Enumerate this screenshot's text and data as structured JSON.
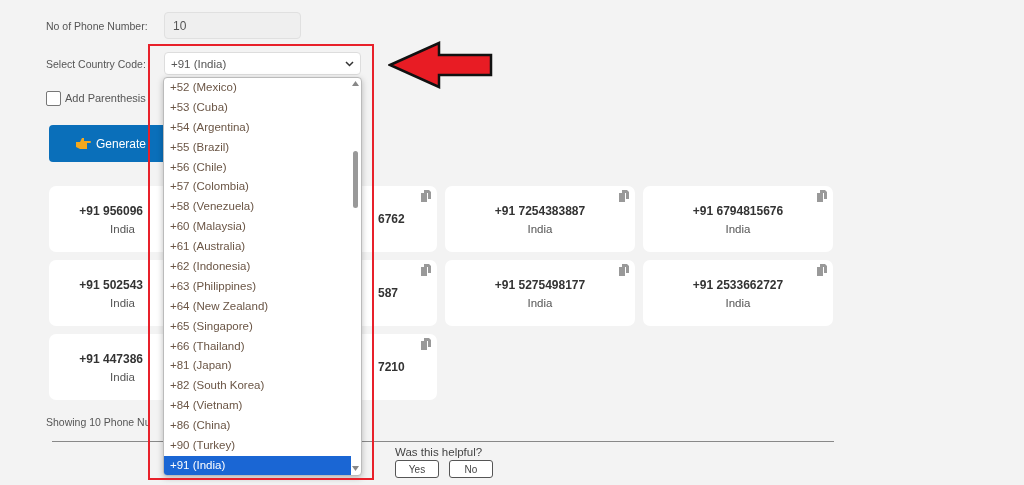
{
  "form": {
    "count_label": "No of Phone Number:",
    "count_value": "10",
    "country_label": "Select Country Code:",
    "country_value": "+91 (India)",
    "parenthesis": {
      "label": "Add Parenthesis",
      "checked": false
    },
    "generate_button": {
      "label": "Generate"
    }
  },
  "dropdown": {
    "options": [
      {
        "label": "+52 (Mexico)",
        "selected": false
      },
      {
        "label": "+53 (Cuba)",
        "selected": false
      },
      {
        "label": "+54 (Argentina)",
        "selected": false
      },
      {
        "label": "+55 (Brazil)",
        "selected": false
      },
      {
        "label": "+56 (Chile)",
        "selected": false
      },
      {
        "label": "+57 (Colombia)",
        "selected": false
      },
      {
        "label": "+58 (Venezuela)",
        "selected": false
      },
      {
        "label": "+60 (Malaysia)",
        "selected": false
      },
      {
        "label": "+61 (Australia)",
        "selected": false
      },
      {
        "label": "+62 (Indonesia)",
        "selected": false
      },
      {
        "label": "+63 (Philippines)",
        "selected": false
      },
      {
        "label": "+64 (New Zealand)",
        "selected": false
      },
      {
        "label": "+65 (Singapore)",
        "selected": false
      },
      {
        "label": "+66 (Thailand)",
        "selected": false
      },
      {
        "label": "+81 (Japan)",
        "selected": false
      },
      {
        "label": "+82 (South Korea)",
        "selected": false
      },
      {
        "label": "+84 (Vietnam)",
        "selected": false
      },
      {
        "label": "+86 (China)",
        "selected": false
      },
      {
        "label": "+90 (Turkey)",
        "selected": false
      },
      {
        "label": "+91 (India)",
        "selected": true
      }
    ]
  },
  "cards": [
    {
      "number": "+91 956096",
      "country": "India",
      "copy_icon": false
    },
    {
      "number": "6762",
      "copy_icon": true
    },
    {
      "number": "+91 7254383887",
      "country": "India",
      "copy_icon": true
    },
    {
      "number": "+91 6794815676",
      "country": "India",
      "copy_icon": true
    },
    {
      "number": "+91 502543",
      "country": "India",
      "copy_icon": false
    },
    {
      "number": "587",
      "copy_icon": true
    },
    {
      "number": "+91 5275498177",
      "country": "India",
      "copy_icon": true
    },
    {
      "number": "+91 2533662727",
      "country": "India",
      "copy_icon": true
    },
    {
      "number": "+91 447386",
      "country": "India",
      "copy_icon": false
    },
    {
      "number": "7210",
      "copy_icon": true
    }
  ],
  "summary": "Showing 10 Phone Nu",
  "feedback": {
    "question": "Was this helpful?",
    "buttons": [
      "Yes",
      "No"
    ]
  }
}
